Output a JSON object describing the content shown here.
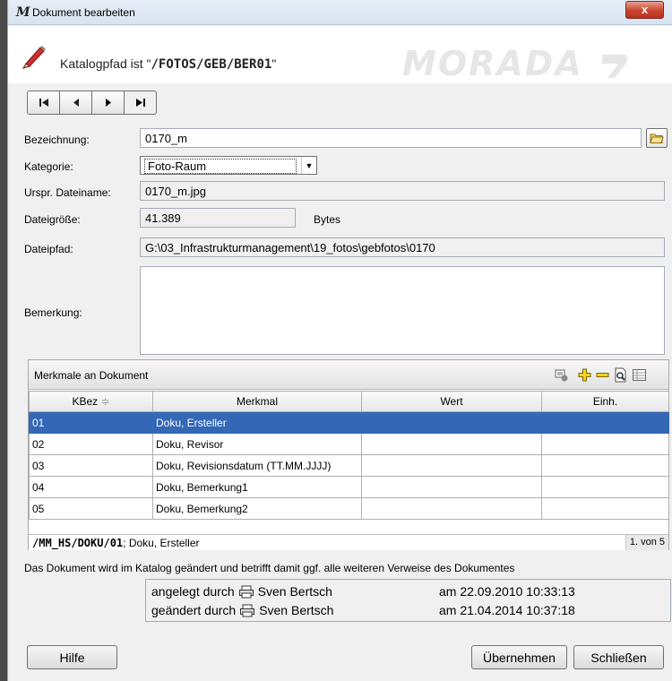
{
  "window": {
    "title": "Dokument bearbeiten",
    "app_icon": "M",
    "close_label": "x"
  },
  "header": {
    "path_label": "Katalogpfad ist \"",
    "path_value": "/FOTOS/GEB/BER01",
    "path_suffix": "\"",
    "logo_text": "MORADA"
  },
  "nav": {
    "first": "first-record-icon",
    "prev": "previous-record-icon",
    "next": "next-record-icon",
    "last": "last-record-icon"
  },
  "form": {
    "bezeichnung_label": "Bezeichnung:",
    "bezeichnung_value": "0170_m",
    "kategorie_label": "Kategorie:",
    "kategorie_value": "Foto-Raum",
    "dateiname_label": "Urspr. Dateiname:",
    "dateiname_value": "0170_m.jpg",
    "groesse_label": "Dateigröße:",
    "groesse_value": "41.389",
    "groesse_unit": "Bytes",
    "pfad_label": "Dateipfad:",
    "pfad_value": "G:\\03_Infrastrukturmanagement\\19_fotos\\gebfotos\\0170",
    "bemerkung_label": "Bemerkung:",
    "bemerkung_value": ""
  },
  "merkmale": {
    "title": "Merkmale an Dokument",
    "columns": [
      "KBez",
      "Merkmal",
      "Wert",
      "Einh."
    ],
    "sort_indicator": "≑",
    "rows": [
      {
        "kbez": "01",
        "merkmal": "Doku, Ersteller",
        "wert": "",
        "einh": ""
      },
      {
        "kbez": "02",
        "merkmal": "Doku, Revisor",
        "wert": "",
        "einh": ""
      },
      {
        "kbez": "03",
        "merkmal": "Doku, Revisionsdatum (TT.MM.JJJJ)",
        "wert": "",
        "einh": ""
      },
      {
        "kbez": "04",
        "merkmal": "Doku, Bemerkung1",
        "wert": "",
        "einh": ""
      },
      {
        "kbez": "05",
        "merkmal": "Doku, Bemerkung2",
        "wert": "",
        "einh": ""
      }
    ],
    "selected_row": 0,
    "footer_code": "/MM_HS/DOKU/01",
    "footer_text": "; Doku, Ersteller",
    "footer_count": "1. von 5"
  },
  "info_text": "Das Dokument wird im Katalog geändert und betrifft damit ggf. alle weiteren Verweise des Dokumentes",
  "audit": {
    "created_label": "angelegt durch",
    "created_by": "Sven Bertsch",
    "created_at": "am  22.09.2010 10:33:13",
    "changed_label": "geändert durch",
    "changed_by": "Sven Bertsch",
    "changed_at": "am  21.04.2014 10:37:18"
  },
  "buttons": {
    "help": "Hilfe",
    "apply": "Übernehmen",
    "close": "Schließen"
  },
  "colors": {
    "selection": "#3467b6",
    "close_button": "#c9432d",
    "accent_plus": "#e8c400"
  }
}
